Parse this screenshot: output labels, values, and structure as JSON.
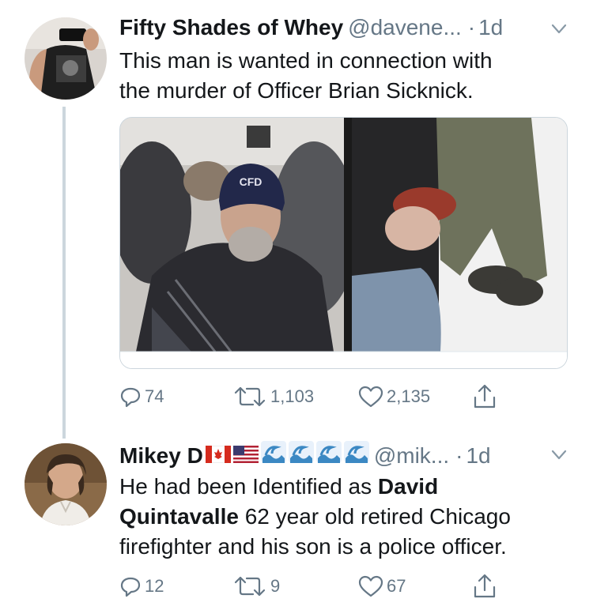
{
  "tweets": [
    {
      "author_name": "Fifty Shades of Whey",
      "handle": "@davene...",
      "separator": "·",
      "time": "1d",
      "text_lines": [
        "This man is wanted in connection with",
        "the murder of Officer Brian Sicknick."
      ],
      "media_labels": [
        "CFD"
      ],
      "replies": "74",
      "retweets": "1,103",
      "likes": "2,135"
    },
    {
      "author_name": "Mikey D",
      "handle": "@mik...",
      "separator": "·",
      "time": "1d",
      "text_line1": "He had been Identified as ",
      "text_bold1": "David",
      "text_bold2": "Quintavalle",
      "text_line2_rest": " 62 year old retired Chicago",
      "text_line3": "firefighter and his son is a police officer.",
      "name_emojis": [
        "canada-flag",
        "us-flag",
        "wave",
        "wave",
        "wave",
        "wave"
      ],
      "replies": "12",
      "retweets": "9",
      "likes": "67"
    }
  ],
  "colors": {
    "text": "#14171a",
    "secondary": "#657786",
    "thread_line": "#ccd6dd"
  }
}
